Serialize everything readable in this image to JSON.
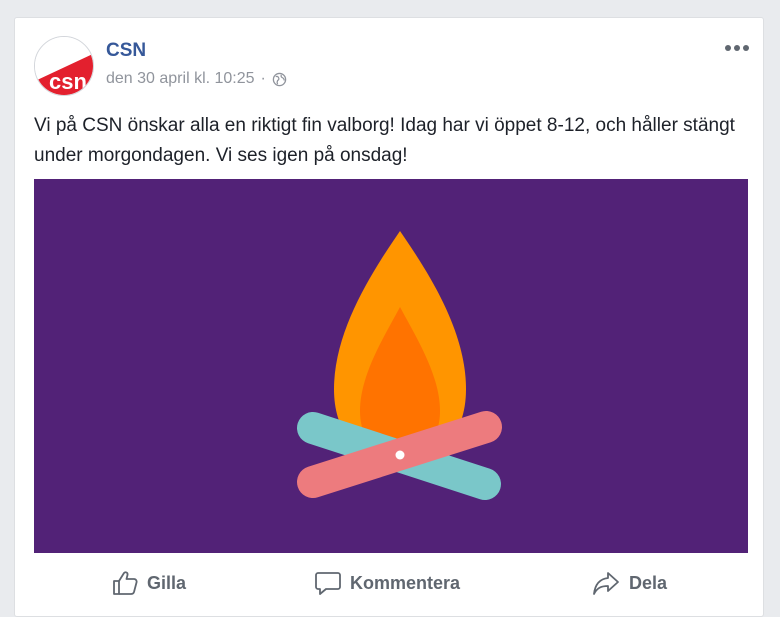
{
  "post": {
    "page_name": "CSN",
    "timestamp": "den 30 april kl. 10:25",
    "separator": "·",
    "privacy_icon": "globe-icon",
    "more_icon": "more-dots-icon",
    "text": "Vi på CSN önskar alla en riktigt fin valborg! Idag har vi öppet 8-12, och håller stängt under morgondagen. Vi ses igen på onsdag!",
    "avatar_logo_text": "csn",
    "image": {
      "description_icon": "campfire-illustration",
      "background_color": "#522277",
      "flame_outer_color": "#ff9500",
      "flame_inner_color": "#ff7300",
      "log_teal_color": "#7ac7c9",
      "log_pink_color": "#ed7b7e"
    }
  },
  "actions": {
    "like_label": "Gilla",
    "comment_label": "Kommentera",
    "share_label": "Dela",
    "like_icon": "thumbs-up-icon",
    "comment_icon": "comment-bubble-icon",
    "share_icon": "share-arrow-icon"
  },
  "colors": {
    "link": "#365899",
    "meta": "#90949c",
    "text": "#1d2129",
    "action": "#606770",
    "brand_red": "#e3202e"
  }
}
